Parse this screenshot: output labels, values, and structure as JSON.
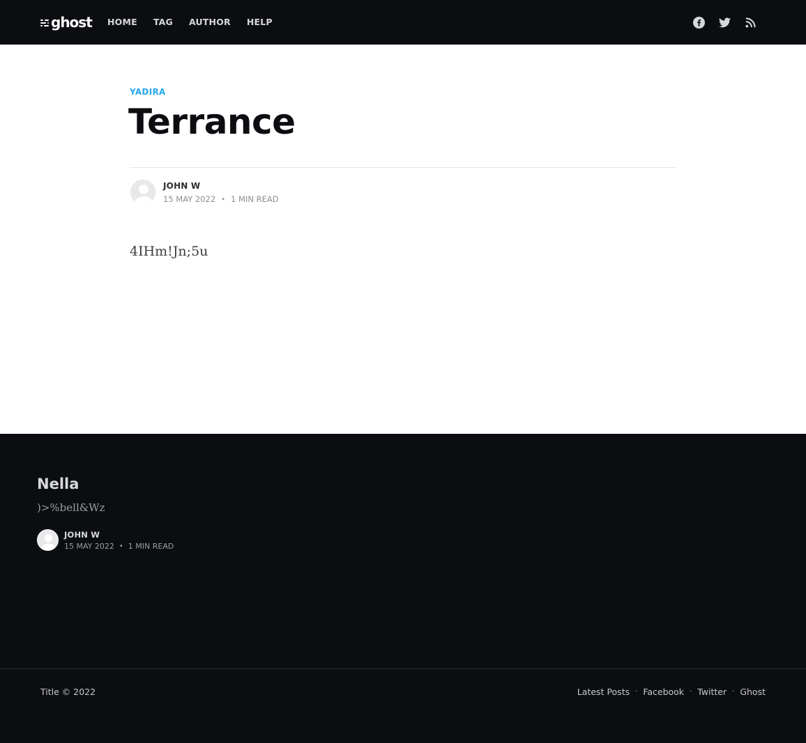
{
  "header": {
    "logo_text": "ghost",
    "nav": [
      "HOME",
      "TAG",
      "AUTHOR",
      "HELP"
    ],
    "social_icons": [
      "facebook-icon",
      "twitter-icon",
      "rss-icon"
    ]
  },
  "article": {
    "tag": "YADIRA",
    "title": "Terrance",
    "author": "JOHN W",
    "date": "15 MAY 2022",
    "separator": "•",
    "reading_time": "1 MIN READ",
    "body": "4IHm!Jn;5u"
  },
  "featured": {
    "title": "Nella",
    "excerpt": ")>%bell&Wz",
    "author": "JOHN W",
    "date": "15 MAY 2022",
    "separator": "•",
    "reading_time": "1 MIN READ"
  },
  "footer": {
    "copyright": "Title © 2022",
    "links": [
      "Latest Posts",
      "Facebook",
      "Twitter",
      "Ghost"
    ],
    "link_separator": "·"
  },
  "colors": {
    "header_bg": "#0c0d10",
    "accent": "#26a8ed",
    "footer_bg": "#0c0d10"
  }
}
